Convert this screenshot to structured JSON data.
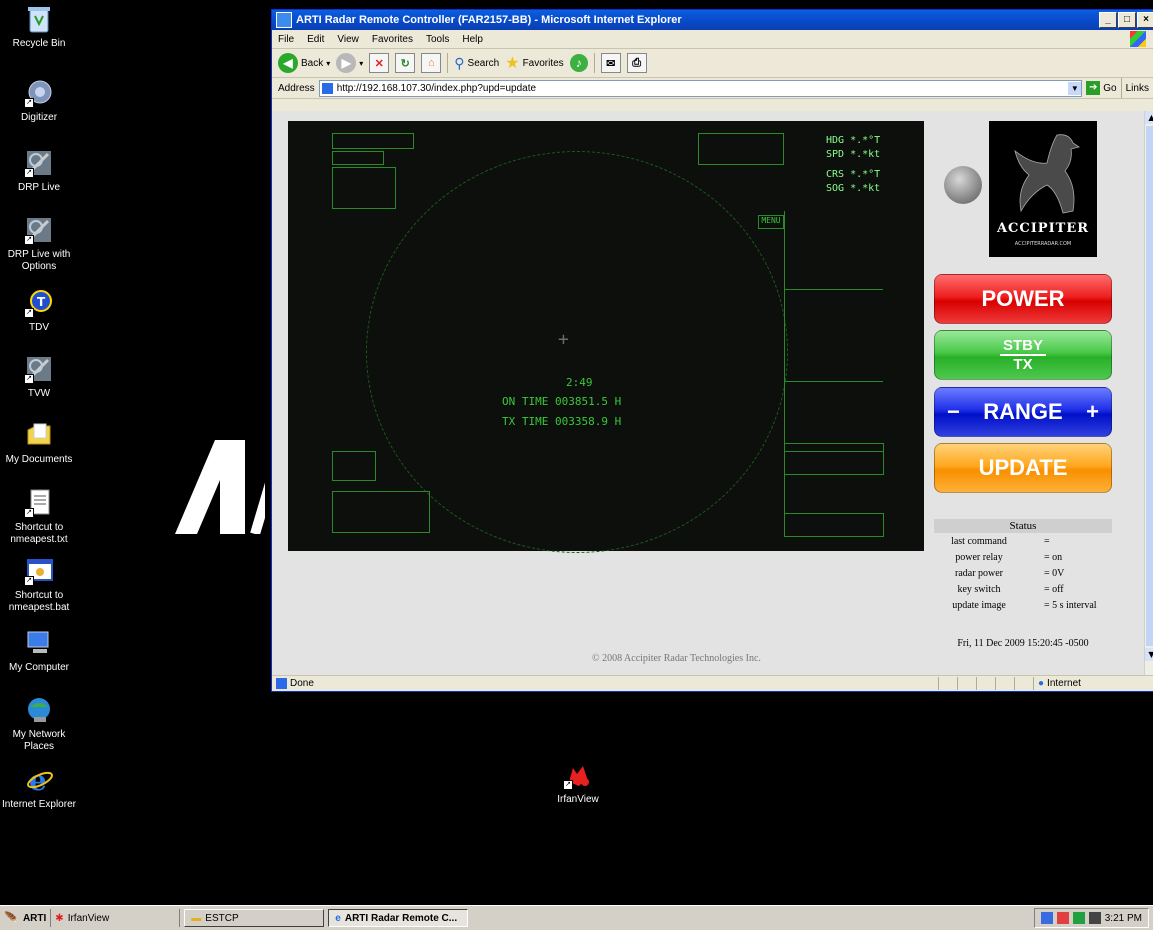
{
  "desktop": {
    "icons": [
      {
        "label": "Recycle Bin"
      },
      {
        "label": "Digitizer"
      },
      {
        "label": "DRP Live"
      },
      {
        "label": "DRP Live with Options"
      },
      {
        "label": "TDV"
      },
      {
        "label": "TVW"
      },
      {
        "label": "My Documents"
      },
      {
        "label": "Shortcut to nmeapest.txt"
      },
      {
        "label": "Shortcut to nmeapest.bat"
      },
      {
        "label": "My Computer"
      },
      {
        "label": "My Network Places"
      },
      {
        "label": "Internet Explorer"
      },
      {
        "label": "IrfanView"
      }
    ]
  },
  "window": {
    "title": "ARTI Radar Remote Controller (FAR2157-BB) - Microsoft Internet Explorer",
    "controls": {
      "minimize": "_",
      "maximize": "□",
      "close": "×"
    },
    "menu": [
      "File",
      "Edit",
      "View",
      "Favorites",
      "Tools",
      "Help"
    ],
    "toolbar": {
      "back": "Back",
      "search": "Search",
      "favorites": "Favorites"
    },
    "address": {
      "label": "Address",
      "url": "http://192.168.107.30/index.php?upd=update",
      "go": "Go",
      "links": "Links"
    },
    "statusbar": {
      "left": "Done",
      "zone": "Internet"
    }
  },
  "radar": {
    "clock": "2:49",
    "on_time": "ON TIME 003851.5 H",
    "tx_time": "TX TIME 003358.9 H",
    "hdg": [
      {
        "k": "HDG",
        "v": "*.*°T"
      },
      {
        "k": "SPD",
        "v": "*.*kt"
      },
      {
        "k": "CRS",
        "v": "*.*°T"
      },
      {
        "k": "SOG",
        "v": "*.*kt"
      }
    ],
    "menu": "MENU"
  },
  "panel": {
    "logo_text": "ACCIPITER",
    "logo_url": "ACCIPITERRADAR.COM",
    "buttons": {
      "power": "POWER",
      "stby": "STBY",
      "tx": "TX",
      "range_minus": "−",
      "range": "RANGE",
      "range_plus": "+",
      "update": "UPDATE"
    },
    "status": {
      "title": "Status",
      "rows": [
        {
          "k": "last command",
          "v": "="
        },
        {
          "k": "power relay",
          "v": "= on"
        },
        {
          "k": "radar power",
          "v": "= 0V"
        },
        {
          "k": "key switch",
          "v": "= off"
        },
        {
          "k": "update image",
          "v": "= 5 s interval"
        }
      ]
    },
    "date": "Fri, 11 Dec 2009 15:20:45 -0500"
  },
  "footer": {
    "copyright": "© 2008 Accipiter Radar Technologies Inc."
  },
  "taskbar": {
    "start": "ARTI",
    "quick": "IrfanView",
    "items": [
      {
        "label": "ESTCP"
      },
      {
        "label": "ARTI Radar Remote C..."
      }
    ],
    "clock": "3:21 PM"
  },
  "colors": {
    "power": "#e81c1c",
    "stby": "#35b935",
    "range": "#1020d8",
    "update": "#ffa020",
    "radar_green": "#39c839",
    "title_blue": "#0848c8"
  }
}
